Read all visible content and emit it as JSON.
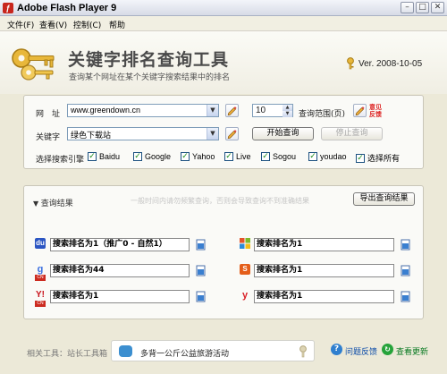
{
  "window": {
    "title": "Adobe Flash Player 9",
    "min": "–",
    "max": "□",
    "close": "✕"
  },
  "menu": [
    "文件(F)",
    "查看(V)",
    "控制(C)",
    "帮助"
  ],
  "banner": {
    "name": "关键字排名查询工具",
    "desc": "查询某个网址在某个关键字搜索结果中的排名",
    "version": "Ver. 2008-10-05"
  },
  "form": {
    "url_label": "网　址",
    "url_value": "www.greendown.cn",
    "range_value": "10",
    "range_label": "查询范围(页)",
    "feedback": [
      "意见",
      "反馈"
    ],
    "keyword_label": "关键字",
    "keyword_value": "绿色下载站",
    "start_button": "开始查询",
    "stop_button": "停止查询",
    "engines_label": "选择搜索引擎",
    "engines": [
      {
        "name": "Baidu",
        "checked": true
      },
      {
        "name": "Google",
        "checked": true
      },
      {
        "name": "Yahoo",
        "checked": true
      },
      {
        "name": "Live",
        "checked": true
      },
      {
        "name": "Sogou",
        "checked": true
      },
      {
        "name": "youdao",
        "checked": true
      },
      {
        "name": "选择所有",
        "checked": true
      }
    ]
  },
  "results": {
    "title": "查询结果",
    "watermark": "一般时间内请勿频繁查询，否则会导致查询不到准确结果",
    "export_button": "导出查询结果",
    "items": [
      {
        "engine": "baidu-icon",
        "text": "搜索排名为1（推广0 - 自然1）",
        "cn": false
      },
      {
        "engine": "live-icon",
        "text": "搜索排名为1",
        "cn": false
      },
      {
        "engine": "google-icon",
        "text": "搜索排名为44",
        "cn": true
      },
      {
        "engine": "sogou-icon",
        "text": "搜索排名为1",
        "cn": false
      },
      {
        "engine": "yahoo-icon",
        "text": "搜索排名为1",
        "cn": true
      },
      {
        "engine": "youdao-icon",
        "text": "搜索排名为1",
        "cn": false
      }
    ]
  },
  "footer": {
    "tools_label": "相关工具：站长工具箱",
    "message": "多背一公斤公益旅游活动",
    "help": "问题反馈",
    "update": "查看更新"
  }
}
